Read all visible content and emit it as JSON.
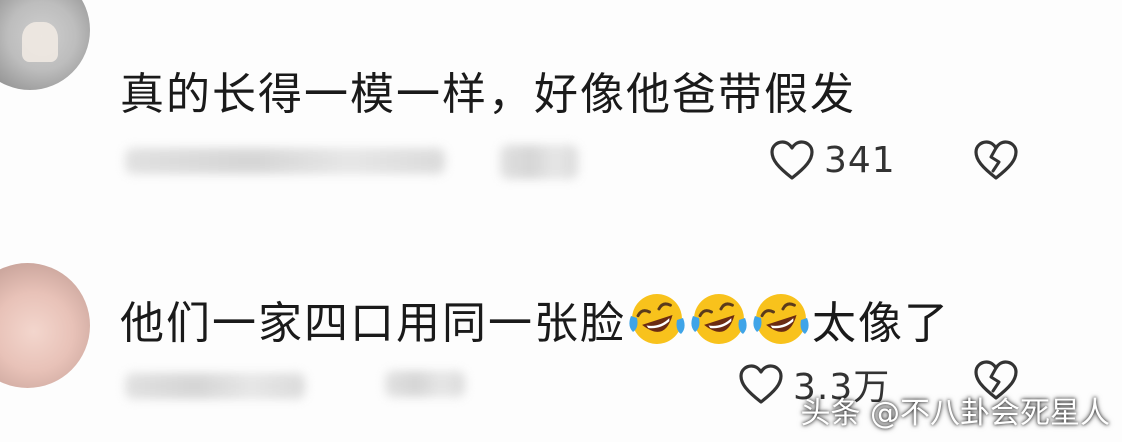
{
  "comments": [
    {
      "text": "真的长得一模一样，好像他爸带假发",
      "likes": "341"
    },
    {
      "text_before_emoji": "他们一家四口用同一张脸",
      "emoji_count": 3,
      "emoji_icon": "face-with-tears-of-joy-icon",
      "text_after_emoji": "太像了",
      "likes": "3.3万"
    }
  ],
  "icons": {
    "like": "heart-outline-icon",
    "dislike": "broken-heart-icon"
  },
  "watermark": "头条 @不八卦会死星人",
  "colors": {
    "background": "#fdfdfd",
    "text": "#1a1a1a",
    "icon": "#333333",
    "emoji_yellow": "#f8c21c",
    "emoji_tear": "#3fa4e8"
  }
}
